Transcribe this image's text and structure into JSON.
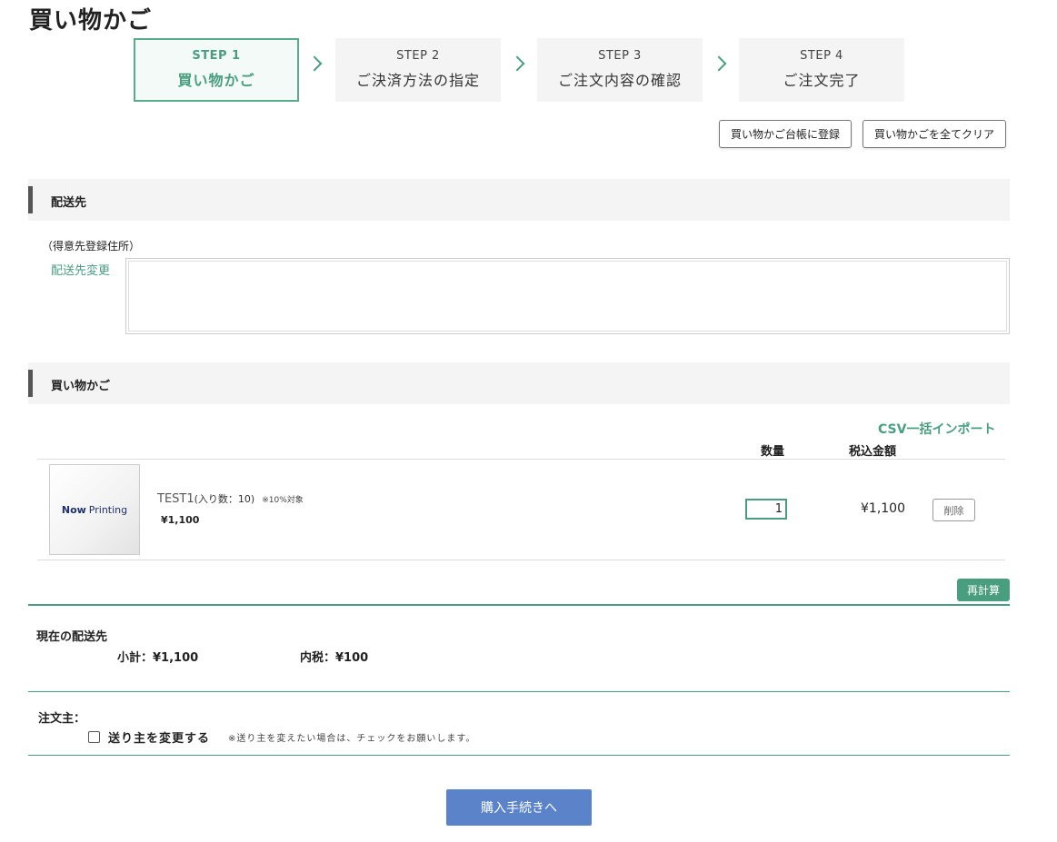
{
  "page": {
    "title": "買い物かご"
  },
  "steps": [
    {
      "num": "STEP 1",
      "label": "買い物かご"
    },
    {
      "num": "STEP 2",
      "label": "ご決済方法の指定"
    },
    {
      "num": "STEP 3",
      "label": "ご注文内容の確認"
    },
    {
      "num": "STEP 4",
      "label": "ご注文完了"
    }
  ],
  "actions": {
    "save_to_ledger": "買い物かご台帳に登録",
    "clear_all": "買い物かごを全てクリア"
  },
  "shipping": {
    "heading": "配送先",
    "registered_label": "（得意先登録住所）",
    "change_link": "配送先変更",
    "address_value": ""
  },
  "cart": {
    "heading": "買い物かご",
    "csv_import": "CSV一括インポート",
    "col_qty": "数量",
    "col_total": "税込金額",
    "items": [
      {
        "thumb_bold": "Now",
        "thumb_light": "Printing",
        "name": "TEST1",
        "sub": "(入り数：10)",
        "note": "※10%対象",
        "price": "¥1,100",
        "qty": "1",
        "total": "¥1,100",
        "delete_label": "削除"
      }
    ],
    "recalc_label": "再計算"
  },
  "summary": {
    "current_dest_label": "現在の配送先",
    "subtotal": "小計：¥1,100",
    "tax": "内税：¥100"
  },
  "orderer": {
    "label": "注文主：",
    "change_checkbox_label": "送り主を変更する",
    "note": "※送り主を変えたい場合は、チェックをお願いします。"
  },
  "checkout": {
    "label": "購入手続きへ"
  },
  "colors": {
    "accent": "#4a9e80",
    "primary": "#5b83c9"
  }
}
